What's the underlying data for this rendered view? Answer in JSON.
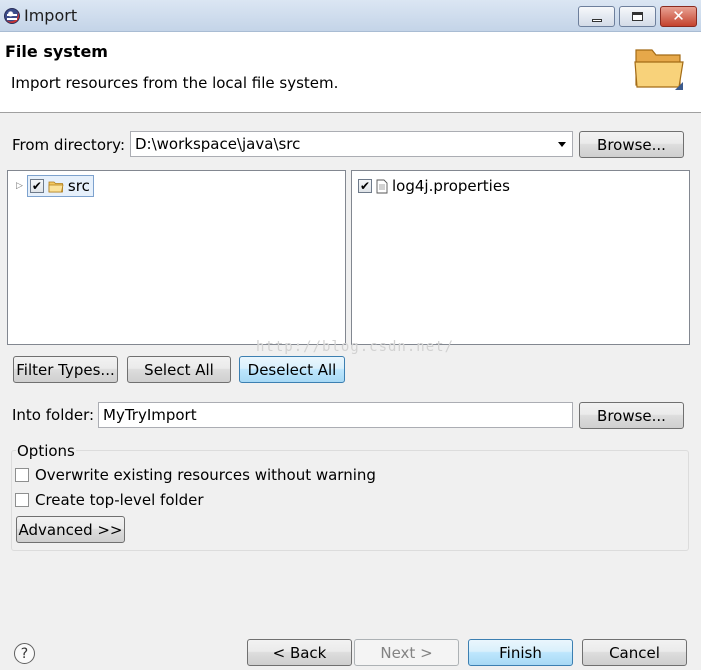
{
  "window": {
    "title": "Import",
    "icon": "eclipse-app-icon"
  },
  "header": {
    "title": "File system",
    "description": "Import resources from the local file system.",
    "icon": "folder-banner-icon"
  },
  "source": {
    "label": "From directory:",
    "value": "D:\\workspace\\java\\src",
    "browse_label": "Browse..."
  },
  "left_tree": {
    "items": [
      {
        "label": "src",
        "checked": true,
        "icon": "folder-icon"
      }
    ]
  },
  "right_list": {
    "items": [
      {
        "label": "log4j.properties",
        "checked": true,
        "icon": "file-icon"
      }
    ]
  },
  "selection_buttons": {
    "filter_types": "Filter Types...",
    "select_all": "Select All",
    "deselect_all": "Deselect All"
  },
  "watermark": "http://blog.csdn.net/",
  "destination": {
    "label": "Into folder:",
    "value": "MyTryImport",
    "browse_label": "Browse..."
  },
  "options": {
    "legend": "Options",
    "overwrite_label": "Overwrite existing resources without warning",
    "overwrite_checked": false,
    "top_level_label": "Create top-level folder",
    "top_level_checked": false,
    "advanced_label": "Advanced >>"
  },
  "footer": {
    "help_glyph": "?",
    "back_label": "< Back",
    "next_label": "Next >",
    "finish_label": "Finish",
    "cancel_label": "Cancel"
  }
}
